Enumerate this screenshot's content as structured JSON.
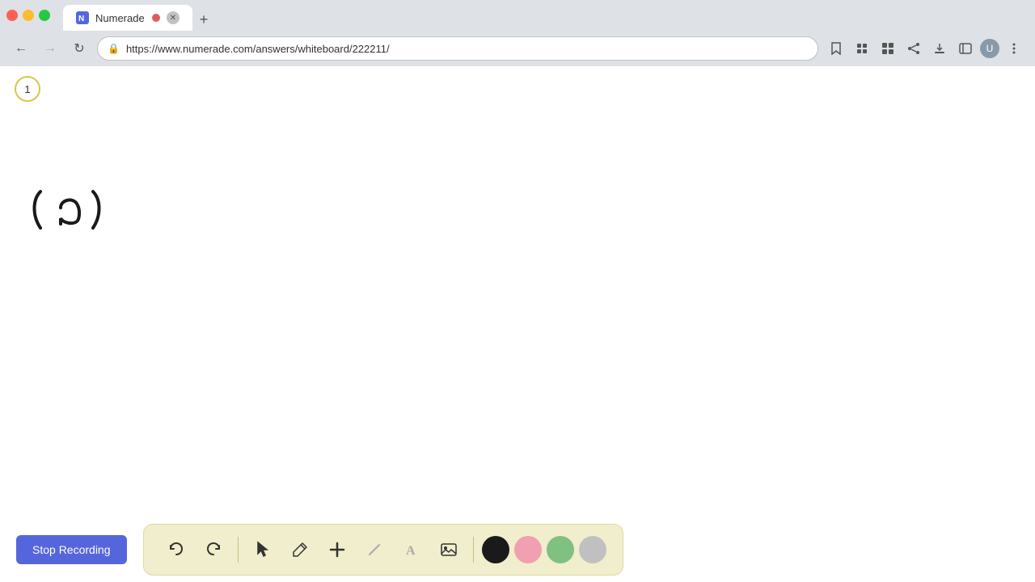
{
  "browser": {
    "tab": {
      "title": "Numerade",
      "url": "https://www.numerade.com/answers/whiteboard/222211/",
      "has_indicator": true
    },
    "nav": {
      "back_disabled": false,
      "forward_disabled": true
    }
  },
  "page": {
    "page_number": "1",
    "handwritten_text": "( a)"
  },
  "toolbar": {
    "stop_recording_label": "Stop Recording",
    "tools": [
      {
        "name": "undo",
        "label": "↩"
      },
      {
        "name": "redo",
        "label": "↪"
      },
      {
        "name": "select",
        "label": "▲"
      },
      {
        "name": "pen",
        "label": "✏"
      },
      {
        "name": "add",
        "label": "+"
      },
      {
        "name": "eraser",
        "label": "/"
      },
      {
        "name": "text",
        "label": "A"
      },
      {
        "name": "image",
        "label": "🖼"
      }
    ],
    "colors": [
      {
        "name": "black",
        "value": "#1a1a1a"
      },
      {
        "name": "pink",
        "value": "#f0a0b0"
      },
      {
        "name": "green",
        "value": "#80c080"
      },
      {
        "name": "gray",
        "value": "#c0c0c0"
      }
    ]
  }
}
